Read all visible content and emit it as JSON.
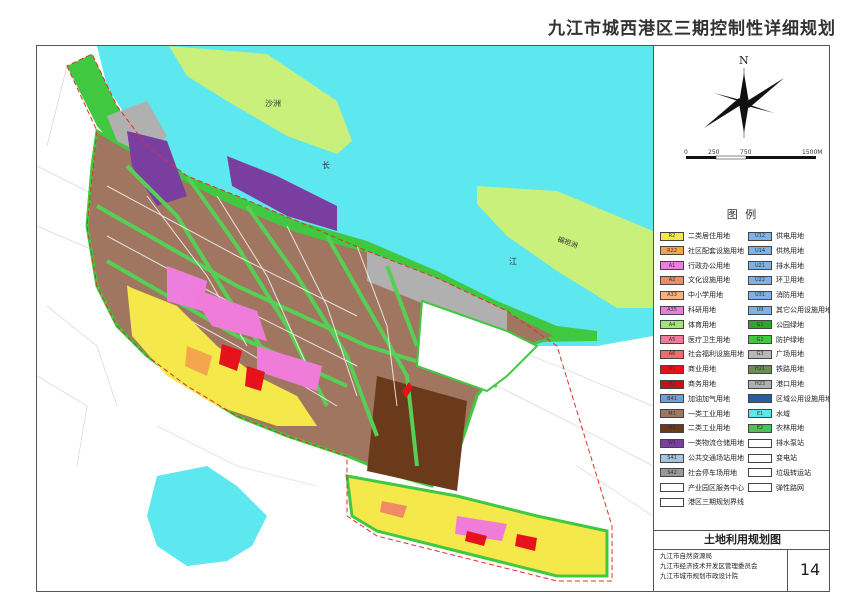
{
  "title": "九江市城西港区三期控制性详细规划",
  "map": {
    "labels": {
      "sand_island": "沙洲",
      "river_char_1": "长",
      "river_char_2": "江",
      "boat_island": "褊担洲"
    }
  },
  "compass": {
    "north": "N"
  },
  "scale": {
    "ticks": [
      "0",
      "250",
      "750",
      "1500M"
    ]
  },
  "legend": {
    "title": "图 例",
    "left": [
      {
        "code": "R2",
        "label": "二类居住用地",
        "color": "#f5e84a"
      },
      {
        "code": "R22",
        "label": "社区配套设施用地",
        "color": "#f4a64c"
      },
      {
        "code": "A1",
        "label": "行政办公用地",
        "color": "#ee7de0"
      },
      {
        "code": "A2",
        "label": "文化设施用地",
        "color": "#f08b68"
      },
      {
        "code": "A33",
        "label": "中小学用地",
        "color": "#f7b37d"
      },
      {
        "code": "A35",
        "label": "科研用地",
        "color": "#ee7cd8"
      },
      {
        "code": "A4",
        "label": "体育用地",
        "color": "#9ee67a"
      },
      {
        "code": "A5",
        "label": "医疗卫生用地",
        "color": "#f37a9e"
      },
      {
        "code": "A6",
        "label": "社会福利设施用地",
        "color": "#f26b6b"
      },
      {
        "code": "B1",
        "label": "商业用地",
        "color": "#e5121c"
      },
      {
        "code": "B2",
        "label": "商务用地",
        "color": "#c9101a"
      },
      {
        "code": "B41",
        "label": "加油加气用地",
        "color": "#6ea0e0"
      },
      {
        "code": "M1",
        "label": "一类工业用地",
        "color": "#a07660"
      },
      {
        "code": "M2",
        "label": "二类工业用地",
        "color": "#6a3a1a"
      },
      {
        "code": "W1",
        "label": "一类物流仓储用地",
        "color": "#7a3ea0"
      },
      {
        "code": "S41",
        "label": "公共交通场站用地",
        "color": "#a8c4dc"
      },
      {
        "code": "S42",
        "label": "社会停车场用地",
        "color": "#9a9a9a"
      },
      {
        "code": "",
        "label": "产业园区服务中心",
        "color": "#ffffff"
      },
      {
        "code": "",
        "label": "港区三期规划界线",
        "color": "#ffffff"
      }
    ],
    "right": [
      {
        "code": "U12",
        "label": "供电用地",
        "color": "#7fb2e6"
      },
      {
        "code": "U14",
        "label": "供热用地",
        "color": "#7fb2e6"
      },
      {
        "code": "U21",
        "label": "排水用地",
        "color": "#7fb2e6"
      },
      {
        "code": "U22",
        "label": "环卫用地",
        "color": "#7fb2e6"
      },
      {
        "code": "U31",
        "label": "消防用地",
        "color": "#7fb2e6"
      },
      {
        "code": "U9",
        "label": "其它公用设施用地",
        "color": "#7fb2e6"
      },
      {
        "code": "G1",
        "label": "公园绿地",
        "color": "#2fa52f"
      },
      {
        "code": "G2",
        "label": "防护绿地",
        "color": "#41c841"
      },
      {
        "code": "G3",
        "label": "广场用地",
        "color": "#b8b8b8"
      },
      {
        "code": "H21",
        "label": "铁路用地",
        "color": "#6b8f50"
      },
      {
        "code": "H23",
        "label": "港口用地",
        "color": "#b0b0b0"
      },
      {
        "code": "",
        "label": "区域公用设施用地",
        "color": "#2a5fa8"
      },
      {
        "code": "E1",
        "label": "水域",
        "color": "#5ce8ee"
      },
      {
        "code": "E2",
        "label": "农林用地",
        "color": "#49c45a"
      },
      {
        "code": "",
        "label": "排水泵站",
        "color": "#ffffff"
      },
      {
        "code": "",
        "label": "变电站",
        "color": "#ffffff"
      },
      {
        "code": "",
        "label": "垃圾转运站",
        "color": "#ffffff"
      },
      {
        "code": "",
        "label": "弹性路网",
        "color": "#ffffff"
      }
    ]
  },
  "plan_title": "土地利用规划图",
  "organizations": [
    "九江市自然资源局",
    "九江市经济技术开发区管理委员会",
    "九江市城市规划市政设计院"
  ],
  "sheet_number": "14"
}
